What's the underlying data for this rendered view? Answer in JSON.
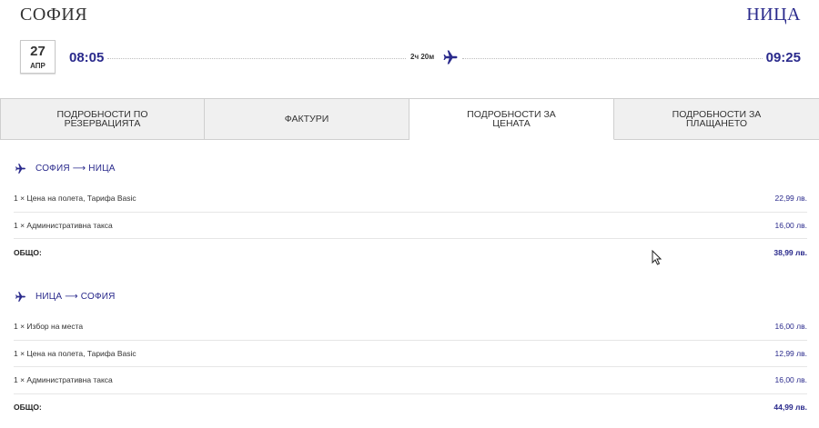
{
  "flight": {
    "from_city": "СОФИЯ",
    "to_city": "НИЦА",
    "date_day": "27",
    "date_month": "АПР",
    "departure_time": "08:05",
    "arrival_time": "09:25",
    "duration": "2ч 20м",
    "plane_icon": "plane-icon"
  },
  "tabs": [
    {
      "label": "ПОДРОБНОСТИ ПО РЕЗЕРВАЦИЯТА",
      "active": false
    },
    {
      "label": "ФАКТУРИ",
      "active": false
    },
    {
      "label": "ПОДРОБНОСТИ ЗА ЦЕНАТА",
      "active": true
    },
    {
      "label": "ПОДРОБНОСТИ ЗА ПЛАЩАНЕТО",
      "active": false
    }
  ],
  "outbound": {
    "route": "СОФИЯ ⟶ НИЦА",
    "items": [
      {
        "label": "1 × Цена на полета, Тарифа Basic",
        "amount": "22,99 лв."
      },
      {
        "label": "1 × Административна такса",
        "amount": "16,00 лв."
      }
    ],
    "total_label": "ОБЩО:",
    "total_amount": "38,99 лв."
  },
  "inbound": {
    "route": "НИЦА ⟶ СОФИЯ",
    "items": [
      {
        "label": "1 × Избор на места",
        "amount": "16,00 лв."
      },
      {
        "label": "1 × Цена на полета, Тарифа Basic",
        "amount": "12,99 лв."
      },
      {
        "label": "1 × Административна такса",
        "amount": "16,00 лв."
      }
    ],
    "total_label": "ОБЩО:",
    "total_amount": "44,99 лв."
  },
  "colors": {
    "accent": "#2a2a8c",
    "tab_inactive_bg": "#f0f0f0",
    "border": "#cfcfcf"
  }
}
